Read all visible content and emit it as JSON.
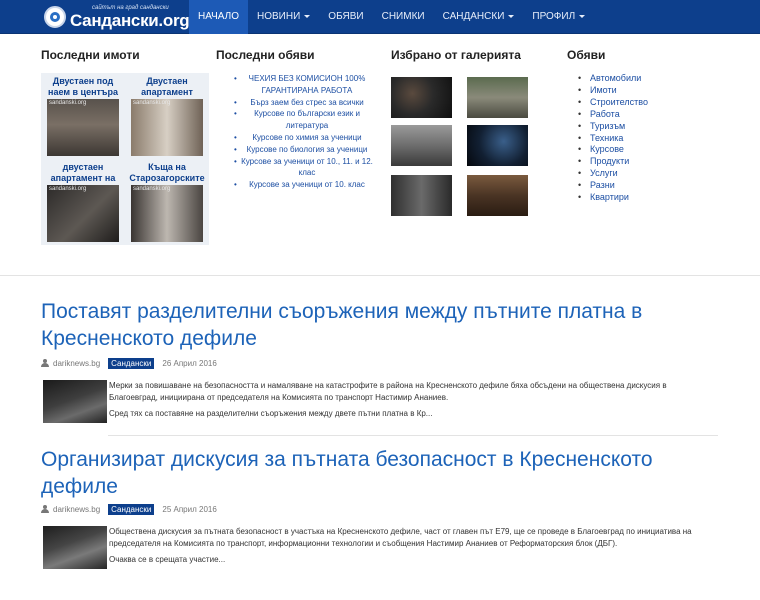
{
  "header": {
    "logo_tagline": "сайтът на град сандански",
    "logo_name": "Сандански.org",
    "nav": [
      {
        "label": "НАЧАЛО",
        "active": true,
        "dropdown": false
      },
      {
        "label": "НОВИНИ",
        "active": false,
        "dropdown": true
      },
      {
        "label": "ОБЯВИ",
        "active": false,
        "dropdown": false
      },
      {
        "label": "СНИМКИ",
        "active": false,
        "dropdown": false
      },
      {
        "label": "САНДАНСКИ",
        "active": false,
        "dropdown": true
      },
      {
        "label": "ПРОФИЛ",
        "active": false,
        "dropdown": true
      }
    ]
  },
  "properties": {
    "heading": "Последни имоти",
    "watermark": "sandanski.org",
    "items": [
      {
        "title": "Двустаен под наем в центъра"
      },
      {
        "title": "Двустаен апартамент"
      },
      {
        "title": "двустаен апартамент на"
      },
      {
        "title": "Къща на Старозагорските"
      }
    ]
  },
  "latest_ads": {
    "heading": "Последни обяви",
    "items": [
      "ЧЕХИЯ БЕЗ КОМИСИОН 100% ГАРАНТИРАНА РАБОТА",
      "Бърз заем без стрес за всички",
      "Курсове по български език и литература",
      "Курсове по химия за ученици",
      "Курсове по биология за ученици",
      "Курсове за ученици от 10., 11. и 12. клас",
      "Курсове за ученици от 10. клас"
    ]
  },
  "gallery": {
    "heading": "Избрано от галерията"
  },
  "categories": {
    "heading": "Обяви",
    "items": [
      "Автомобили",
      "Имоти",
      "Строителство",
      "Работа",
      "Туризъм",
      "Техника",
      "Курсове",
      "Продукти",
      "Услуги",
      "Разни",
      "Квартири"
    ]
  },
  "articles": [
    {
      "title": "Поставят разделителни съоръжения между пътните платна в Кресненското дефиле",
      "author": "dariknews.bg",
      "category": "Сандански",
      "date": "26 Април 2016",
      "paragraphs": [
        "Мерки за повишаване на безопасността и намаляване на катастрофите в района на Кресненското дефиле бяха обсъдени на обществена дискусия в Благоевград, инициирана от председателя на Комисията по транспорт Настимир Ананиев.",
        "Сред тях са поставяне на разделителни съоръжения между двете пътни платна в Кр..."
      ]
    },
    {
      "title": "Организират дискусия за пътната безопасност в Кресненското дефиле",
      "author": "dariknews.bg",
      "category": "Сандански",
      "date": "25 Април 2016",
      "paragraphs": [
        "Обществена дискусия за  пътната безопасност в участъка на Кресненското дефиле, част от главен път Е79, ще се проведе в Благоевград по инициатива на председателя на Комисията по транспорт, информационни технологии и съобщения Настимир Ананиев от Реформаторския блок (ДБГ).",
        "Очаква се в срещата участие..."
      ]
    }
  ]
}
